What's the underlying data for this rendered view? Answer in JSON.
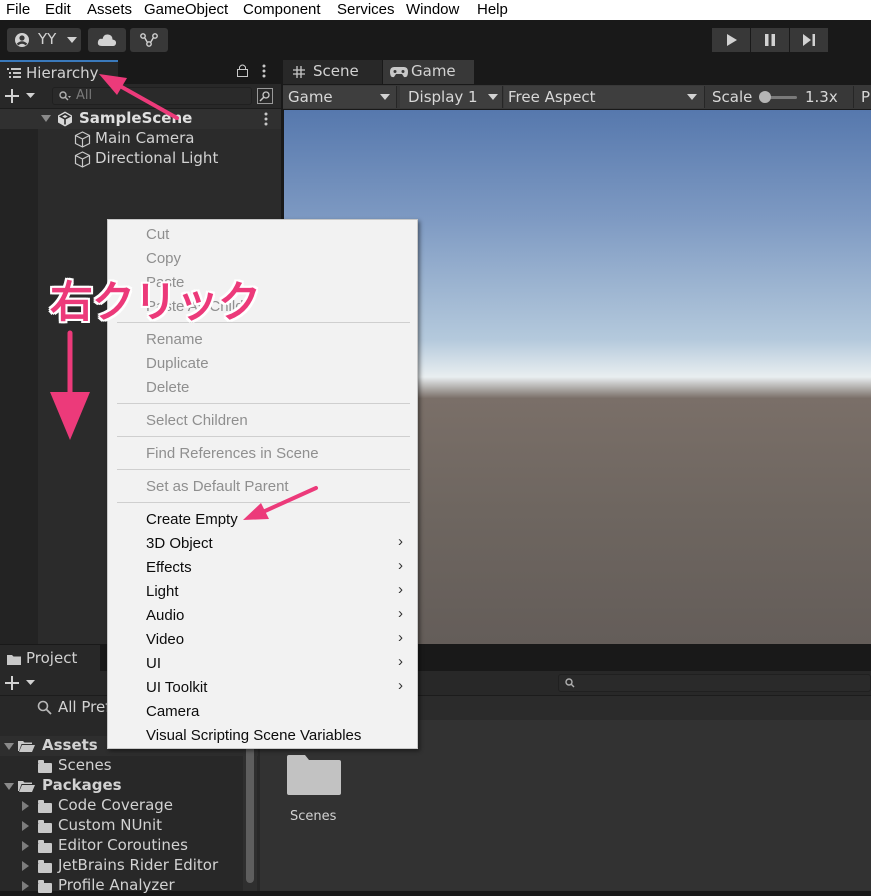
{
  "menubar": {
    "items": [
      "File",
      "Edit",
      "Assets",
      "GameObject",
      "Component",
      "Services",
      "Window",
      "Help"
    ]
  },
  "toolbar": {
    "account_label": "YY"
  },
  "hierarchy": {
    "tab_label": "Hierarchy",
    "search_placeholder": "All",
    "scene_name": "SampleScene",
    "objects": [
      "Main Camera",
      "Directional Light"
    ]
  },
  "game": {
    "tabs": [
      "Scene",
      "Game"
    ],
    "mode_select": "Game",
    "display_select": "Display 1",
    "aspect_select": "Free Aspect",
    "scale_label": "Scale",
    "scale_value": "1.3x",
    "cut_label": "P"
  },
  "project": {
    "tab_label": "Project",
    "search_label": "All Pref",
    "tree": {
      "assets": "Assets",
      "scenes": "Scenes",
      "packages": "Packages",
      "package_items": [
        "Code Coverage",
        "Custom NUnit",
        "Editor Coroutines",
        "JetBrains Rider Editor",
        "Profile Analyzer"
      ]
    },
    "grid_items": [
      "Scenes"
    ]
  },
  "context_menu": {
    "groups": [
      [
        "Cut",
        "Copy",
        "Paste",
        "Paste As Child"
      ],
      [
        "Rename",
        "Duplicate",
        "Delete"
      ],
      [
        "Select Children"
      ],
      [
        "Find References in Scene"
      ],
      [
        "Set as Default Parent"
      ]
    ],
    "create_items": [
      {
        "label": "Create Empty",
        "submenu": false
      },
      {
        "label": "3D Object",
        "submenu": true
      },
      {
        "label": "Effects",
        "submenu": true
      },
      {
        "label": "Light",
        "submenu": true
      },
      {
        "label": "Audio",
        "submenu": true
      },
      {
        "label": "Video",
        "submenu": true
      },
      {
        "label": "UI",
        "submenu": true
      },
      {
        "label": "UI Toolkit",
        "submenu": true
      },
      {
        "label": "Camera",
        "submenu": false
      },
      {
        "label": "Visual Scripting Scene Variables",
        "submenu": false
      }
    ],
    "submenu_glyph": "›"
  },
  "annotation": {
    "text": "右クリック",
    "color": "#ec3a7a"
  }
}
